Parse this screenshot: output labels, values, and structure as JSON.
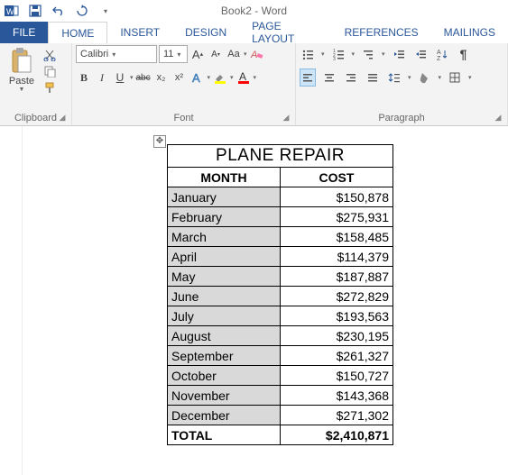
{
  "app": {
    "doc_title": "Book2 - Word"
  },
  "tabs": {
    "file": "FILE",
    "home": "HOME",
    "insert": "INSERT",
    "design": "DESIGN",
    "pagelayout": "PAGE LAYOUT",
    "references": "REFERENCES",
    "mailings": "MAILINGS"
  },
  "ribbon": {
    "clipboard": {
      "label": "Clipboard",
      "paste": "Paste"
    },
    "font": {
      "label": "Font",
      "name": "Calibri",
      "size": "11",
      "bold": "B",
      "italic": "I",
      "underline": "U",
      "strike": "abc",
      "sub": "x₂",
      "sup": "x²",
      "case": "Aa",
      "grow": "A",
      "shrink": "A"
    },
    "paragraph": {
      "label": "Paragraph"
    }
  },
  "table": {
    "title": "PLANE REPAIR",
    "headers": {
      "month": "MONTH",
      "cost": "COST"
    },
    "rows": [
      {
        "month": "January",
        "cost": "$150,878"
      },
      {
        "month": "February",
        "cost": "$275,931"
      },
      {
        "month": "March",
        "cost": "$158,485"
      },
      {
        "month": "April",
        "cost": "$114,379"
      },
      {
        "month": "May",
        "cost": "$187,887"
      },
      {
        "month": "June",
        "cost": "$272,829"
      },
      {
        "month": "July",
        "cost": "$193,563"
      },
      {
        "month": "August",
        "cost": "$230,195"
      },
      {
        "month": "September",
        "cost": "$261,327"
      },
      {
        "month": "October",
        "cost": "$150,727"
      },
      {
        "month": "November",
        "cost": "$143,368"
      },
      {
        "month": "December",
        "cost": "$271,302"
      }
    ],
    "total": {
      "label": "TOTAL",
      "cost": "$2,410,871"
    }
  }
}
